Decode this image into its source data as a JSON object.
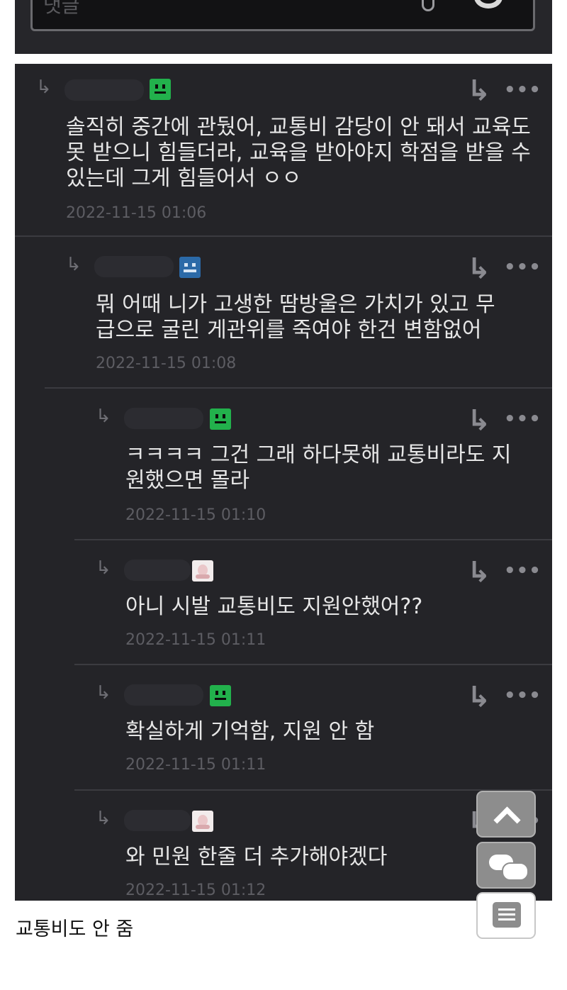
{
  "search": {
    "placeholder_fragment": "댓글"
  },
  "comments": [
    {
      "text": "솔직히 중간에 관뒀어, 교통비 감당이 안 돼서 교육도 못 받으니 힘들더라, 교육을 받아야지 학점을 받을 수 있는데 그게 힘들어서 ㅇㅇ",
      "date": "2022-11-15 01:06",
      "avatar": "green-face-icon",
      "level": 0
    },
    {
      "text": "뭐 어때 니가 고생한 땀방울은 가치가 있고 무급으로 굴린 게관위를 죽여야 한건 변함없어",
      "date": "2022-11-15 01:08",
      "avatar": "blue-robot-icon",
      "level": 1
    },
    {
      "text": "ㅋㅋㅋㅋ 그건 그래 하다못해 교통비라도 지원했으면 몰라",
      "date": "2022-11-15 01:10",
      "avatar": "green-face-icon",
      "level": 2
    },
    {
      "text": "아니 시발 교통비도 지원안했어??",
      "date": "2022-11-15 01:11",
      "avatar": "pink-character-icon",
      "level": 2
    },
    {
      "text": "확실하게 기억함, 지원 안 함",
      "date": "2022-11-15 01:11",
      "avatar": "green-face-icon",
      "level": 2
    },
    {
      "text": "와 민원 한줄 더 추가해야겠다",
      "date": "2022-11-15 01:12",
      "avatar": "pink-character-icon",
      "level": 2
    }
  ],
  "icons": {
    "reply": "reply-arrow-icon",
    "more": "more-dots-icon",
    "indent": "indent-arrow-icon"
  },
  "floating_buttons": [
    "scroll-top-icon",
    "comments-icon",
    "list-icon"
  ],
  "caption": "교통비도 안 줌"
}
